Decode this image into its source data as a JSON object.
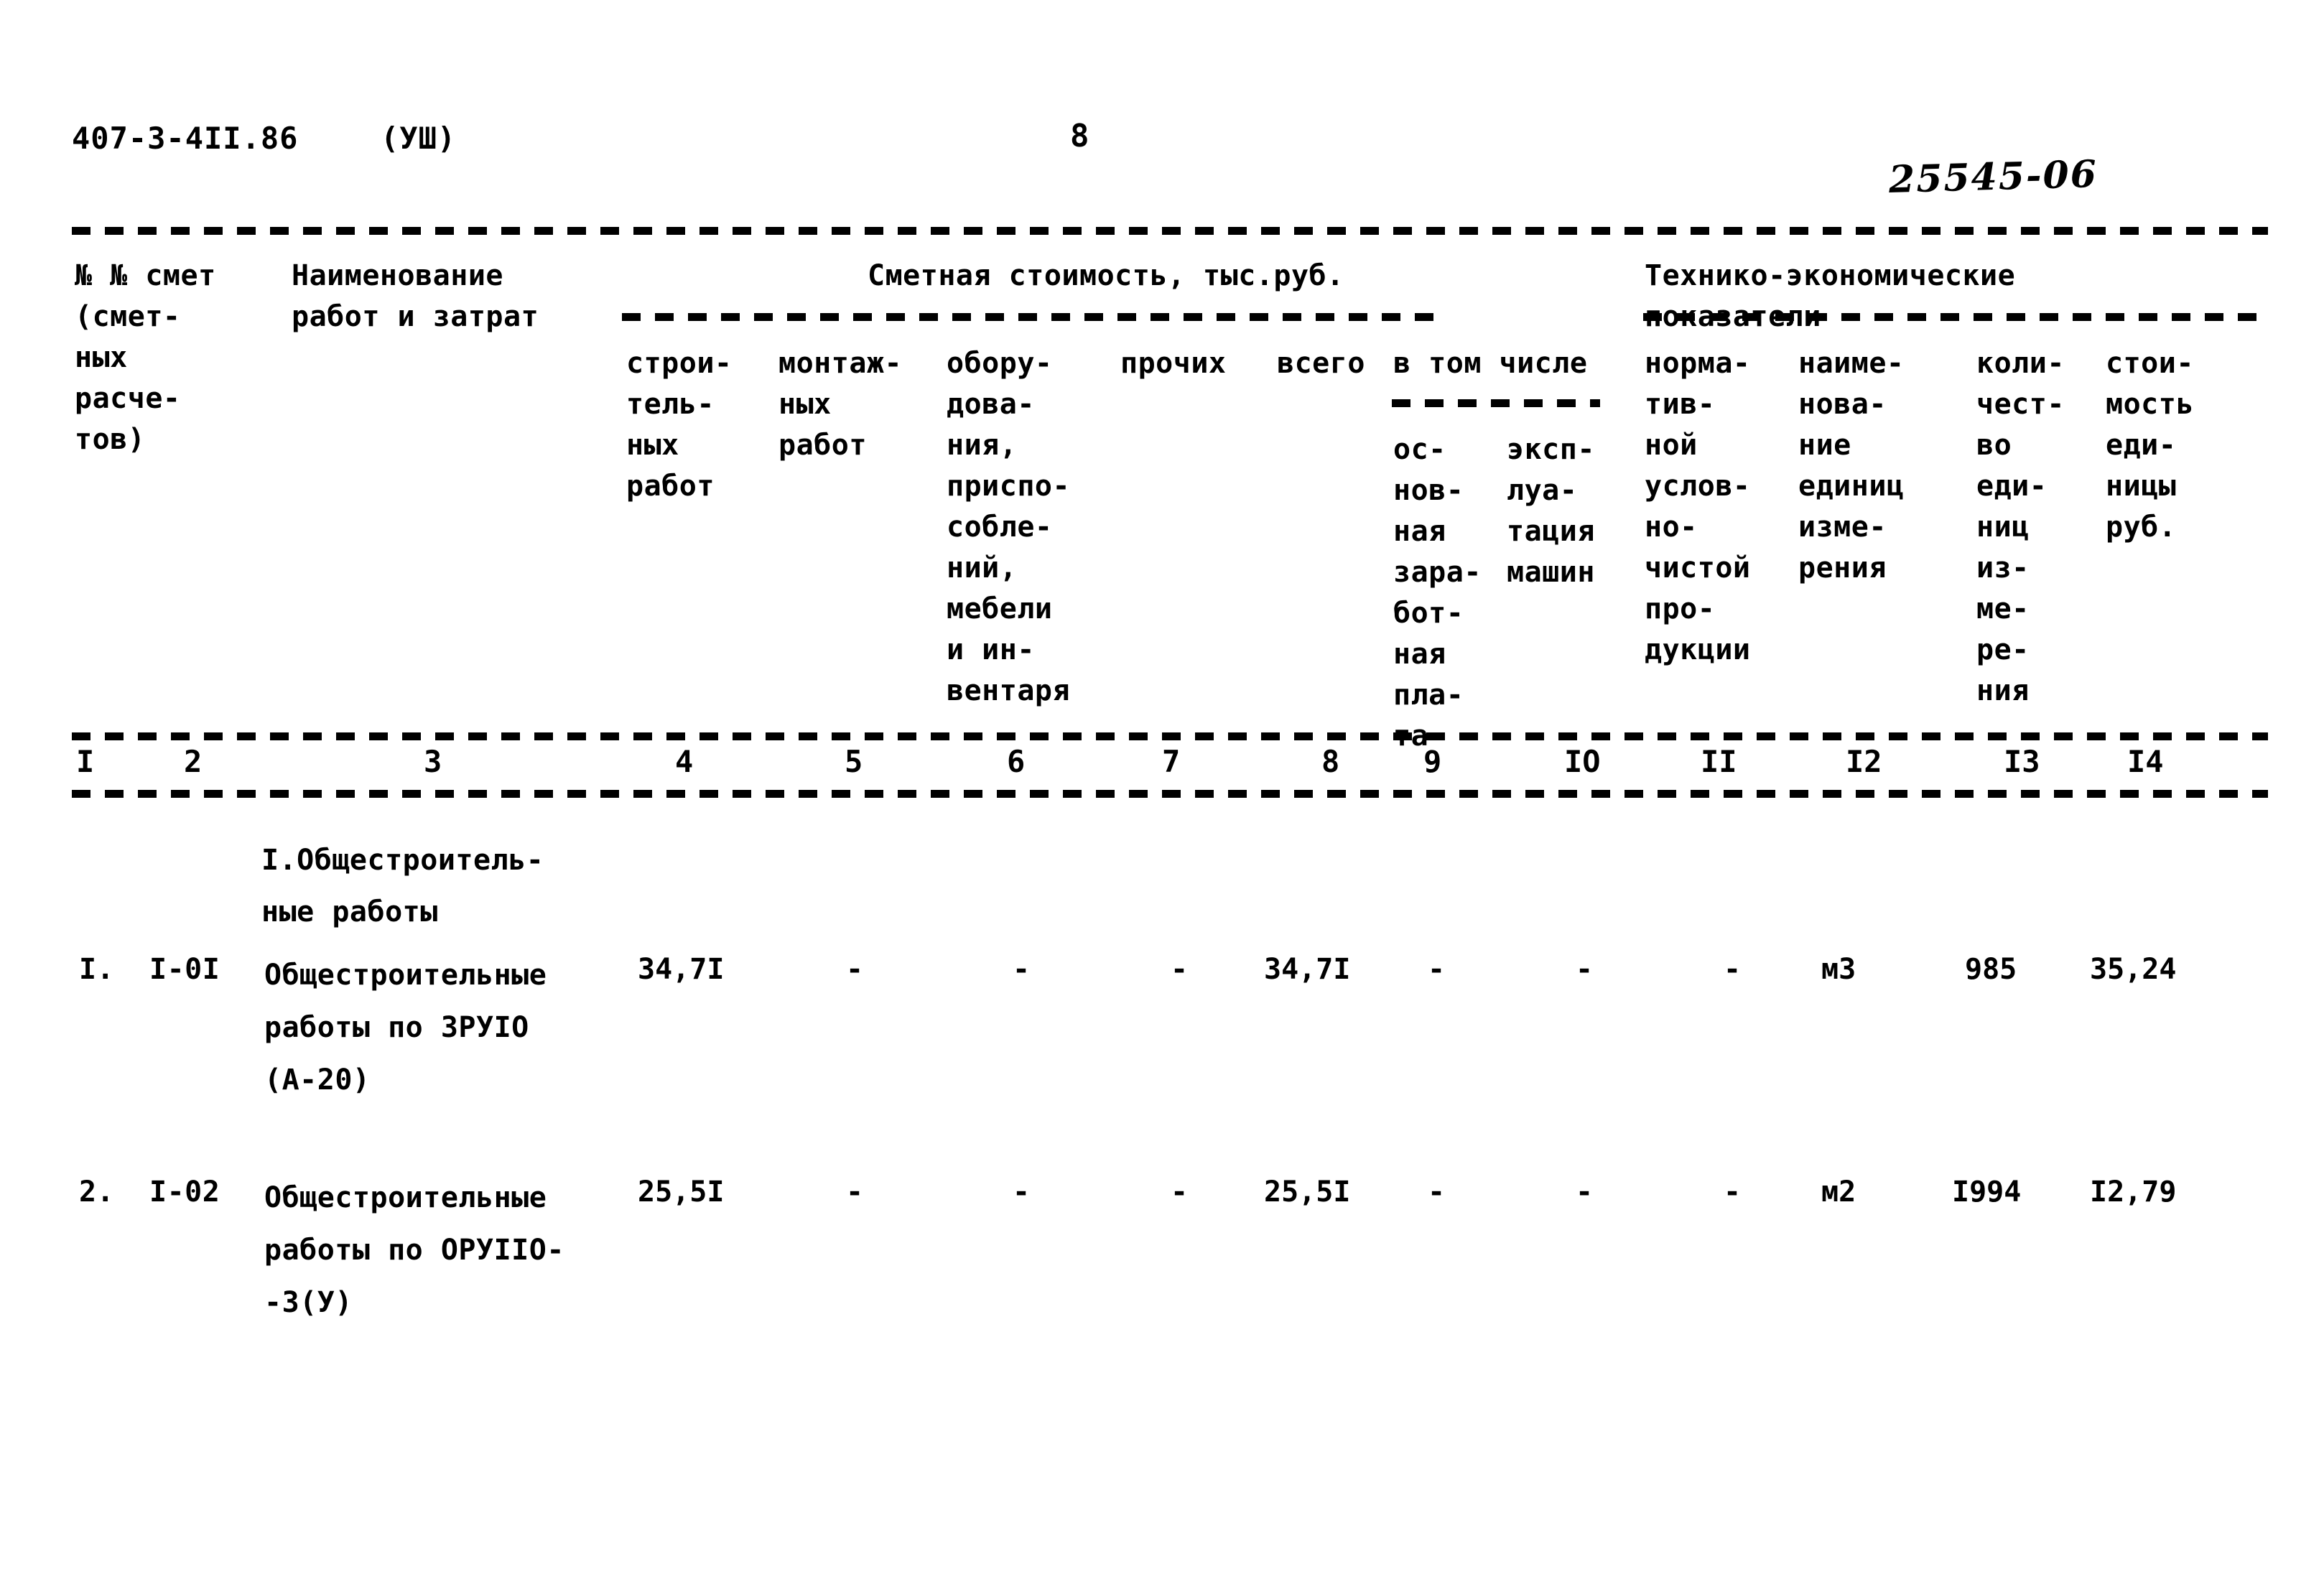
{
  "document": {
    "code": "407-3-4II.86",
    "volume": "(УШ)",
    "page_number": "8",
    "archive_number": "25545-06"
  },
  "table": {
    "header": {
      "col1": "№ № смет\n(смет-\nных\nрасче-\nтов)",
      "col2_3": "Наименование\nработ и затрат",
      "group_cost": "Сметная стоимость, тыс.руб.",
      "group_tei": "Технико-экономические\nпоказатели",
      "col4": "строи-\nтель-\nных\nработ",
      "col5": "монтаж-\nных\nработ",
      "col6": "обору-\nдова-\nния,\nприспо-\nсобле-\nний,\nмебели\nи ин-\nвентаря",
      "col7": "прочих",
      "col8": "всего",
      "group_inc": "в том числе",
      "col9": "ос-\nнов-\nная\nзара-\nбот-\nная\nпла-\nта",
      "col10": "эксп-\nлуа-\nтация\nмашин",
      "col11": "норма-\nтив-\nной\nуслов-\nно-\nчистой\nпро-\nдукции",
      "col12": "наиме-\nнова-\nние\nединиц\nизме-\nрения",
      "col13": "коли-\nчест-\nво\nеди-\nниц\nиз-\nме-\nре-\nния",
      "col14": "стои-\nмость\nеди-\nницы\nруб."
    },
    "column_numbers": [
      "I",
      "2",
      "3",
      "4",
      "5",
      "6",
      "7",
      "8",
      "9",
      "IO",
      "II",
      "I2",
      "I3",
      "I4"
    ],
    "section_title": "I.Общестроитель-\nные работы",
    "rows": [
      {
        "no": "I.",
        "estimate_no": "I-0I",
        "description": "Общестроительные\nработы по ЗРУIO\n(А-20)",
        "c4": "34,7I",
        "c5": "-",
        "c6": "-",
        "c7": "-",
        "c8": "34,7I",
        "c9": "-",
        "c10": "-",
        "c11": "-",
        "c12": "м3",
        "c13": "985",
        "c14": "35,24"
      },
      {
        "no": "2.",
        "estimate_no": "I-02",
        "description": "Общестроительные\nработы по ОРУIIО-\n-3(У)",
        "c4": "25,5I",
        "c5": "-",
        "c6": "-",
        "c7": "-",
        "c8": "25,5I",
        "c9": "-",
        "c10": "-",
        "c11": "-",
        "c12": "м2",
        "c13": "I994",
        "c14": "I2,79"
      }
    ]
  }
}
